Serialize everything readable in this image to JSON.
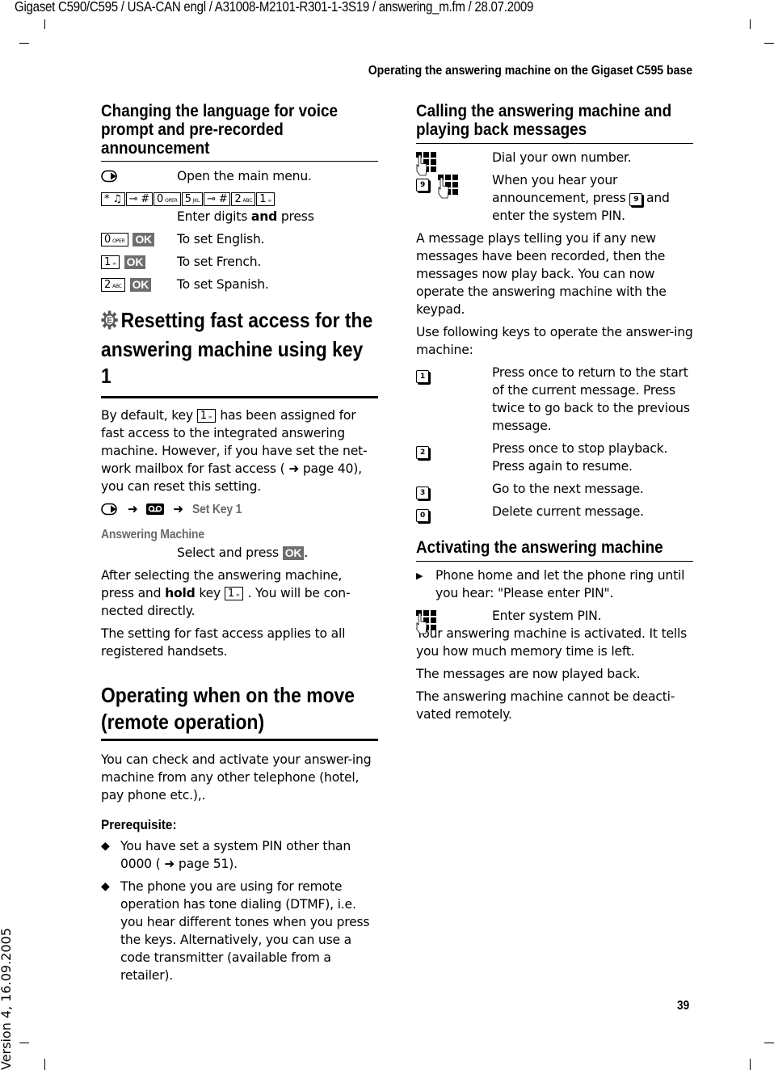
{
  "header": {
    "file_line": "Gigaset C590/C595 / USA-CAN engl / A31008-M2101-R301-1-3S19 / answering_m.fm / 28.07.2009",
    "running_head": "Operating the answering machine on the Gigaset C595 base",
    "page_number": "39",
    "version_note": "Version 4, 16.09.2005"
  },
  "left": {
    "lang_section": {
      "title": "Changing the language for voice prompt and pre-recorded announcement",
      "rows": [
        {
          "icon": "menu-key-icon",
          "text": "Open the main menu."
        },
        {
          "keys": [
            "* ♫",
            "⊸ #",
            "0",
            "5",
            "⊸ #",
            "2",
            "1"
          ],
          "key_subs": [
            "",
            "",
            "OPER",
            "JKL",
            "",
            "ABC",
            "∞"
          ],
          "text_pre": "Enter digits ",
          "text_bold": "and",
          "text_post": " press"
        },
        {
          "key": "0",
          "key_sub": "OPER",
          "ok": "OK",
          "text": "To set English."
        },
        {
          "key": "1",
          "key_sub": "∞",
          "ok": "OK",
          "text": "To set French."
        },
        {
          "key": "2",
          "key_sub": "ABC",
          "ok": "OK",
          "text": "To set Spanish."
        }
      ]
    },
    "reset_section": {
      "icon_letter": "E",
      "title": "Resetting fast access for the answering machine using key 1",
      "para1_pre": "By default, key ",
      "para1_key": "1",
      "para1_key_sub": "∞",
      "para1_post": " has been assigned for fast access to the integrated answering machine. However, if you have set the net-work mailbox for fast access ( ➜  page 40), you can reset this setting.",
      "nav_arrow": "➜",
      "nav_item": "Set Key 1",
      "menu_item": "Answering Machine",
      "select_text": "Select and press ",
      "ok": "OK",
      "para2_pre": "After selecting the answering machine, press and ",
      "para2_bold": "hold",
      "para2_mid": " key ",
      "para2_post": " . You will be con-nected directly.",
      "para3": "The setting for fast access applies to all registered handsets."
    },
    "remote_section": {
      "title": "Operating when on the move (remote operation)",
      "intro": "You can check and activate your answer-ing machine from any other telephone (hotel, pay phone etc.),.",
      "prereq_label": "Prerequisite:",
      "bullets": [
        "You have set a system PIN other than 0000 ( ➜  page 51).",
        "The phone you are using for remote operation has tone dialing (DTMF), i.e. you hear different tones when you press the keys. Alternatively, you can use a code transmitter (available from a retailer)."
      ]
    }
  },
  "right": {
    "calling_section": {
      "title": "Calling the answering machine and playing back messages",
      "row1": "Dial your own number.",
      "row2_key": "9",
      "row2_pre": "When you hear your announcement, press ",
      "row2_post": " and enter the system PIN.",
      "para1": "A message plays telling you if any new messages have been recorded, then the messages now play back. You can now operate the answering machine with the keypad.",
      "para2": " Use following keys to operate the answer-ing machine:",
      "keys": [
        {
          "key": "1",
          "text": "Press once to return to the start of the current message. Press twice to go back to the previous message."
        },
        {
          "key": "2",
          "text": "Press once to stop playback. Press again to resume."
        },
        {
          "key": "3",
          "text": "Go to the next message."
        },
        {
          "key": "0",
          "text": "Delete current message."
        }
      ]
    },
    "activate_section": {
      "title": "Activating the answering machine",
      "step": "Phone home and let the phone ring until you hear: \"Please enter PIN\".",
      "pin_row": "Enter system PIN.",
      "para1": "Your answering machine is activated. It tells you how much memory time is left.",
      "para2": "The messages are now played back.",
      "para3": "The answering machine cannot be deacti-vated remotely."
    }
  },
  "colors": {
    "ok_badge": "#6e6e6e",
    "menu_text_gray": "#6a6a6a"
  }
}
